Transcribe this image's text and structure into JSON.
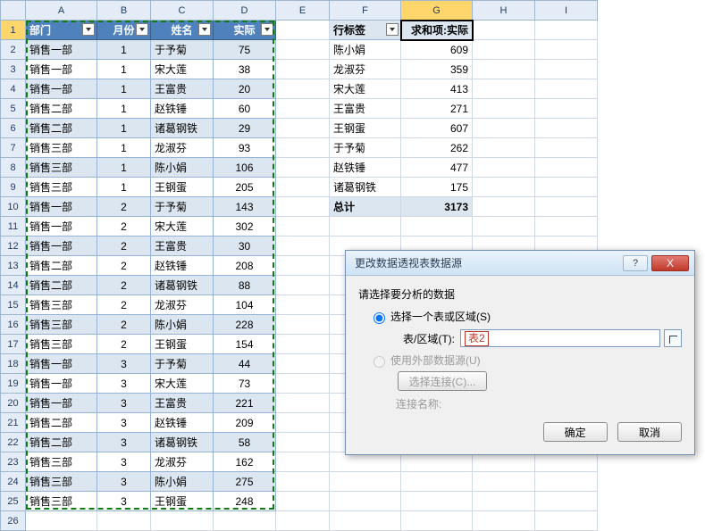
{
  "column_letters": [
    "A",
    "B",
    "C",
    "D",
    "E",
    "F",
    "G",
    "H",
    "I"
  ],
  "active_col": "G",
  "row_count": 26,
  "active_row": 1,
  "table": {
    "headers": [
      "部门",
      "月份",
      "姓名",
      "实际"
    ],
    "rows": [
      [
        "销售一部",
        "1",
        "于予菊",
        "75"
      ],
      [
        "销售一部",
        "1",
        "宋大莲",
        "38"
      ],
      [
        "销售一部",
        "1",
        "王富贵",
        "20"
      ],
      [
        "销售二部",
        "1",
        "赵铁锤",
        "60"
      ],
      [
        "销售二部",
        "1",
        "诸葛钢铁",
        "29"
      ],
      [
        "销售三部",
        "1",
        "龙淑芬",
        "93"
      ],
      [
        "销售三部",
        "1",
        "陈小娟",
        "106"
      ],
      [
        "销售三部",
        "1",
        "王钢蛋",
        "205"
      ],
      [
        "销售一部",
        "2",
        "于予菊",
        "143"
      ],
      [
        "销售一部",
        "2",
        "宋大莲",
        "302"
      ],
      [
        "销售一部",
        "2",
        "王富贵",
        "30"
      ],
      [
        "销售二部",
        "2",
        "赵铁锤",
        "208"
      ],
      [
        "销售二部",
        "2",
        "诸葛钢铁",
        "88"
      ],
      [
        "销售三部",
        "2",
        "龙淑芬",
        "104"
      ],
      [
        "销售三部",
        "2",
        "陈小娟",
        "228"
      ],
      [
        "销售三部",
        "2",
        "王钢蛋",
        "154"
      ],
      [
        "销售一部",
        "3",
        "于予菊",
        "44"
      ],
      [
        "销售一部",
        "3",
        "宋大莲",
        "73"
      ],
      [
        "销售一部",
        "3",
        "王富贵",
        "221"
      ],
      [
        "销售二部",
        "3",
        "赵铁锤",
        "209"
      ],
      [
        "销售二部",
        "3",
        "诸葛钢铁",
        "58"
      ],
      [
        "销售三部",
        "3",
        "龙淑芬",
        "162"
      ],
      [
        "销售三部",
        "3",
        "陈小娟",
        "275"
      ],
      [
        "销售三部",
        "3",
        "王钢蛋",
        "248"
      ]
    ]
  },
  "pivot": {
    "row_label": "行标签",
    "value_label": "求和项:实际",
    "rows": [
      {
        "name": "陈小娟",
        "value": "609"
      },
      {
        "name": "龙淑芬",
        "value": "359"
      },
      {
        "name": "宋大莲",
        "value": "413"
      },
      {
        "name": "王富贵",
        "value": "271"
      },
      {
        "name": "王钢蛋",
        "value": "607"
      },
      {
        "name": "于予菊",
        "value": "262"
      },
      {
        "name": "赵铁锤",
        "value": "477"
      },
      {
        "name": "诸葛钢铁",
        "value": "175"
      }
    ],
    "total_label": "总计",
    "total_value": "3173"
  },
  "dialog": {
    "title": "更改数据透视表数据源",
    "prompt": "请选择要分析的数据",
    "radio_table": "选择一个表或区域(S)",
    "field_label": "表/区域(T):",
    "field_value": "表2",
    "radio_external": "使用外部数据源(U)",
    "choose_conn": "选择连接(C)...",
    "conn_name_label": "连接名称:",
    "ok": "确定",
    "cancel": "取消",
    "help": "?",
    "close": "X"
  }
}
